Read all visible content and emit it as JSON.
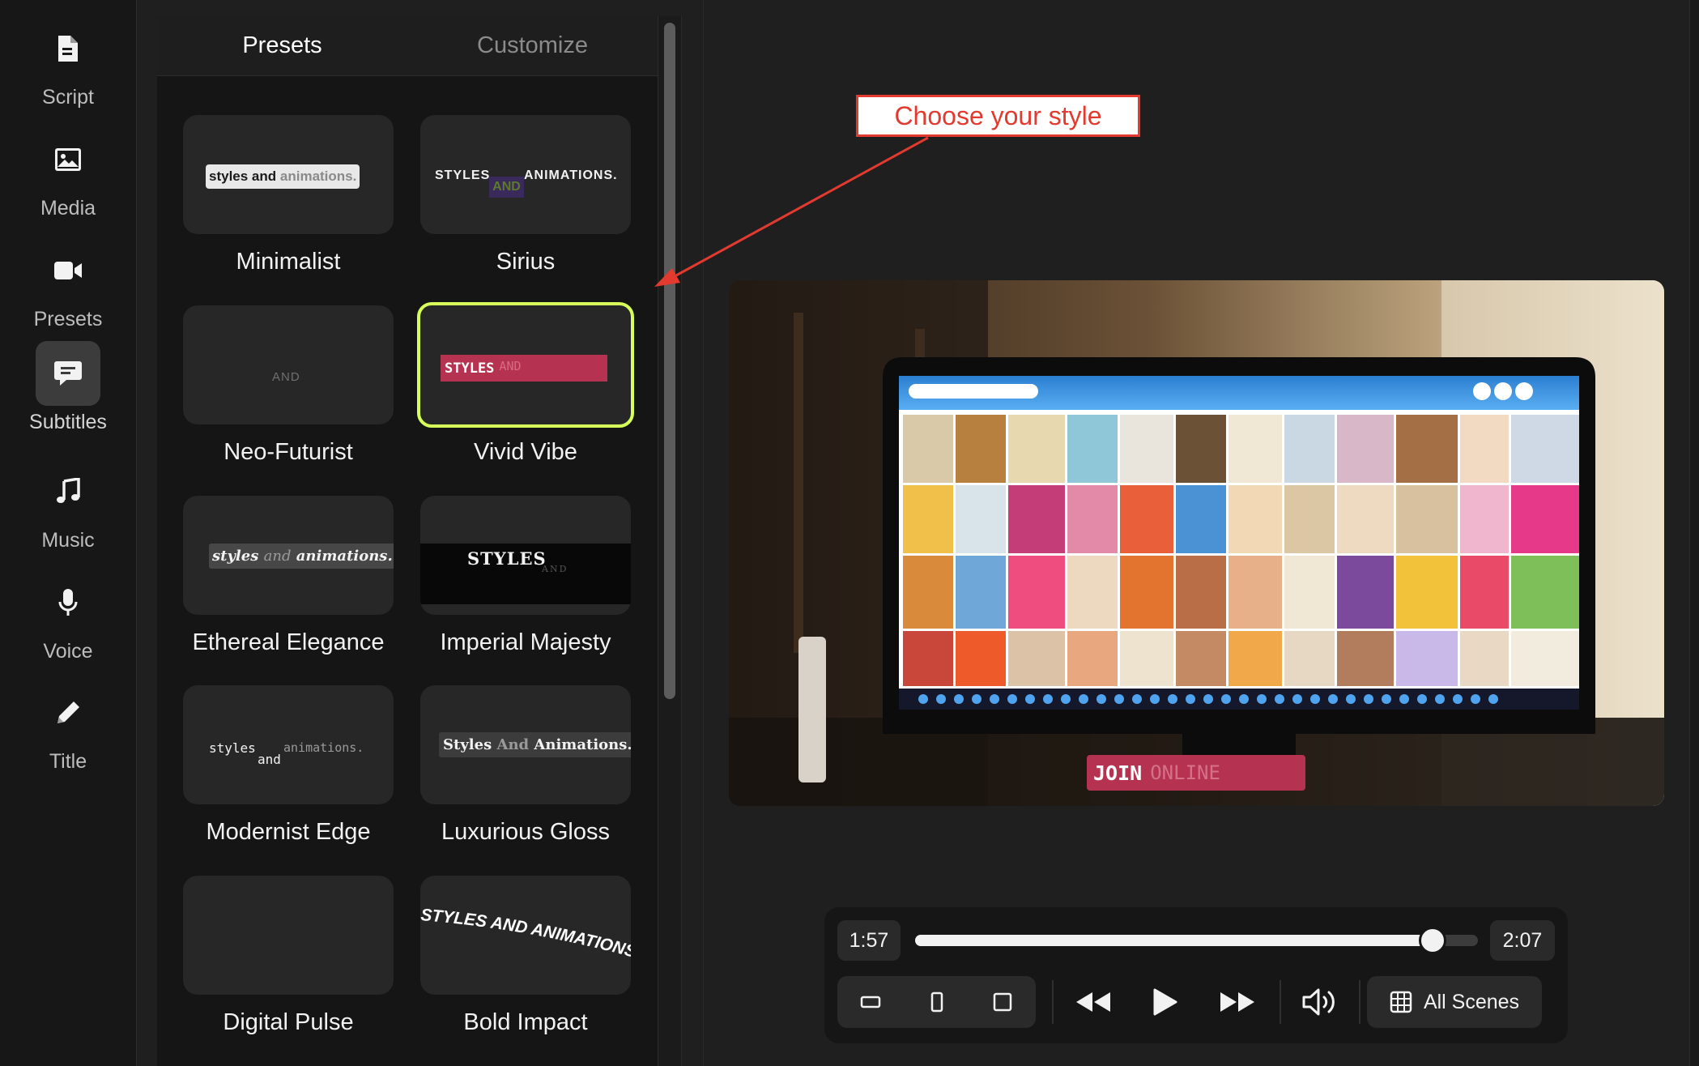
{
  "sidebar": {
    "items": [
      {
        "label": "Script",
        "icon": "document-icon"
      },
      {
        "label": "Media",
        "icon": "image-icon"
      },
      {
        "label": "Presets",
        "icon": "video-camera-icon"
      },
      {
        "label": "Subtitles",
        "icon": "chat-bubble-icon",
        "active": true
      },
      {
        "label": "Music",
        "icon": "music-note-icon"
      },
      {
        "label": "Voice",
        "icon": "microphone-icon"
      },
      {
        "label": "Title",
        "icon": "pencil-icon"
      }
    ]
  },
  "panel": {
    "tabs": [
      {
        "label": "Presets",
        "active": true
      },
      {
        "label": "Customize",
        "active": false
      }
    ],
    "presets": [
      {
        "name": "Minimalist",
        "preview": {
          "w1": "styles and",
          "w2": "animations."
        }
      },
      {
        "name": "Sirius",
        "preview": {
          "w1": "STYLES",
          "w2": "AND",
          "w3": "ANIMATIONS."
        }
      },
      {
        "name": "Neo-Futurist",
        "preview": {
          "w1": "AND"
        }
      },
      {
        "name": "Vivid Vibe",
        "selected": true,
        "preview": {
          "w1": "STYLES",
          "w2": "AND"
        }
      },
      {
        "name": "Ethereal Elegance",
        "preview": {
          "w1": "styles",
          "w2": "and",
          "w3": "animations."
        }
      },
      {
        "name": "Imperial Majesty",
        "preview": {
          "w1": "STYLES",
          "w2": "AND"
        }
      },
      {
        "name": "Modernist Edge",
        "preview": {
          "w1": "styles",
          "w2": "and",
          "w3": "animations."
        }
      },
      {
        "name": "Luxurious Gloss",
        "preview": {
          "w1": "Styles",
          "w2": "And",
          "w3": "Animations."
        }
      },
      {
        "name": "Digital Pulse",
        "preview": {}
      },
      {
        "name": "Bold Impact",
        "preview": {
          "w1": "STYLES AND ANIMATIONS."
        }
      }
    ]
  },
  "annotation": {
    "text": "Choose your style",
    "color": "#e23a2e"
  },
  "video": {
    "caption_word1": "JOIN",
    "caption_word2": "ONLINE"
  },
  "player": {
    "current_time": "1:57",
    "total_time": "2:07",
    "progress": 0.92,
    "aspect_buttons": [
      "landscape-aspect-icon",
      "portrait-aspect-icon",
      "square-aspect-icon"
    ],
    "transport": [
      "rewind-icon",
      "play-icon",
      "fast-forward-icon"
    ],
    "volume_icon": "volume-icon",
    "all_scenes_label": "All Scenes"
  },
  "colors": {
    "accent_selected": "#d6ff59",
    "vivid_caption": "#b53350",
    "background": "#1f1f1f"
  }
}
